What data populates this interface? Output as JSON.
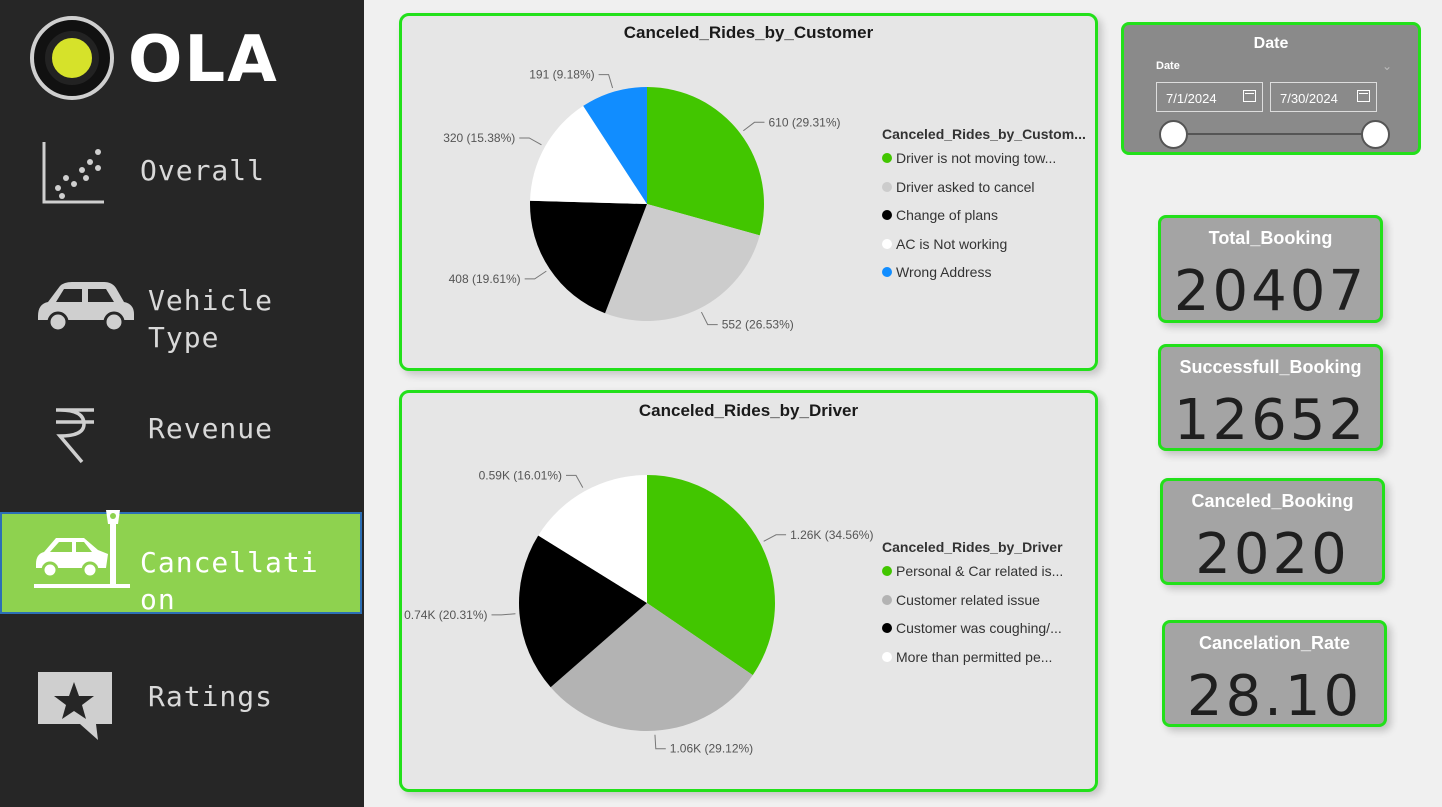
{
  "brand": {
    "logo_text": "OLA"
  },
  "nav": [
    {
      "label": "Overall",
      "icon": "scatter-chart-icon"
    },
    {
      "label": "Vehicle Type",
      "icon": "car-icon"
    },
    {
      "label": "Revenue",
      "icon": "rupee-icon"
    },
    {
      "label": "Cancellation",
      "icon": "car-crash-icon",
      "active": true
    },
    {
      "label": "Ratings",
      "icon": "star-message-icon"
    }
  ],
  "date_slicer": {
    "title": "Date",
    "field_label": "Date",
    "start": "7/1/2024",
    "end": "7/30/2024"
  },
  "kpis": [
    {
      "label": "Total_Booking",
      "value": "20407"
    },
    {
      "label": "Successfull_Booking",
      "value": "12652"
    },
    {
      "label": "Canceled_Booking",
      "value": "2020"
    },
    {
      "label": "Cancelation_Rate",
      "value": "28.10"
    }
  ],
  "colors": {
    "accent_green": "#22e01a",
    "active_nav": "#8ed24f"
  },
  "chart_data": [
    {
      "type": "pie",
      "title": "Canceled_Rides_by_Customer",
      "legend_title": "Canceled_Rides_by_Custom...",
      "legend_position": "right",
      "categories": [
        "Driver is not moving tow...",
        "Driver asked to cancel",
        "Change of plans",
        "AC is Not working",
        "Wrong Address"
      ],
      "values": [
        610,
        552,
        408,
        320,
        191
      ],
      "percents": [
        29.31,
        26.53,
        19.61,
        15.38,
        9.18
      ],
      "data_labels": [
        "610 (29.31%)",
        "552 (26.53%)",
        "408 (19.61%)",
        "320 (15.38%)",
        "191 (9.18%)"
      ],
      "colors": [
        "#42c600",
        "#cccccc",
        "#000000",
        "#ffffff",
        "#118dff"
      ]
    },
    {
      "type": "pie",
      "title": "Canceled_Rides_by_Driver",
      "legend_title": "Canceled_Rides_by_Driver",
      "legend_position": "right",
      "categories": [
        "Personal & Car related is...",
        "Customer related issue",
        "Customer was coughing/...",
        "More than permitted pe..."
      ],
      "values": [
        1260,
        1060,
        740,
        590
      ],
      "percents": [
        34.56,
        29.12,
        20.31,
        16.01
      ],
      "data_labels": [
        "1.26K (34.56%)",
        "1.06K (29.12%)",
        "0.74K (20.31%)",
        "0.59K (16.01%)"
      ],
      "colors": [
        "#42c600",
        "#b3b3b3",
        "#000000",
        "#ffffff"
      ]
    }
  ]
}
